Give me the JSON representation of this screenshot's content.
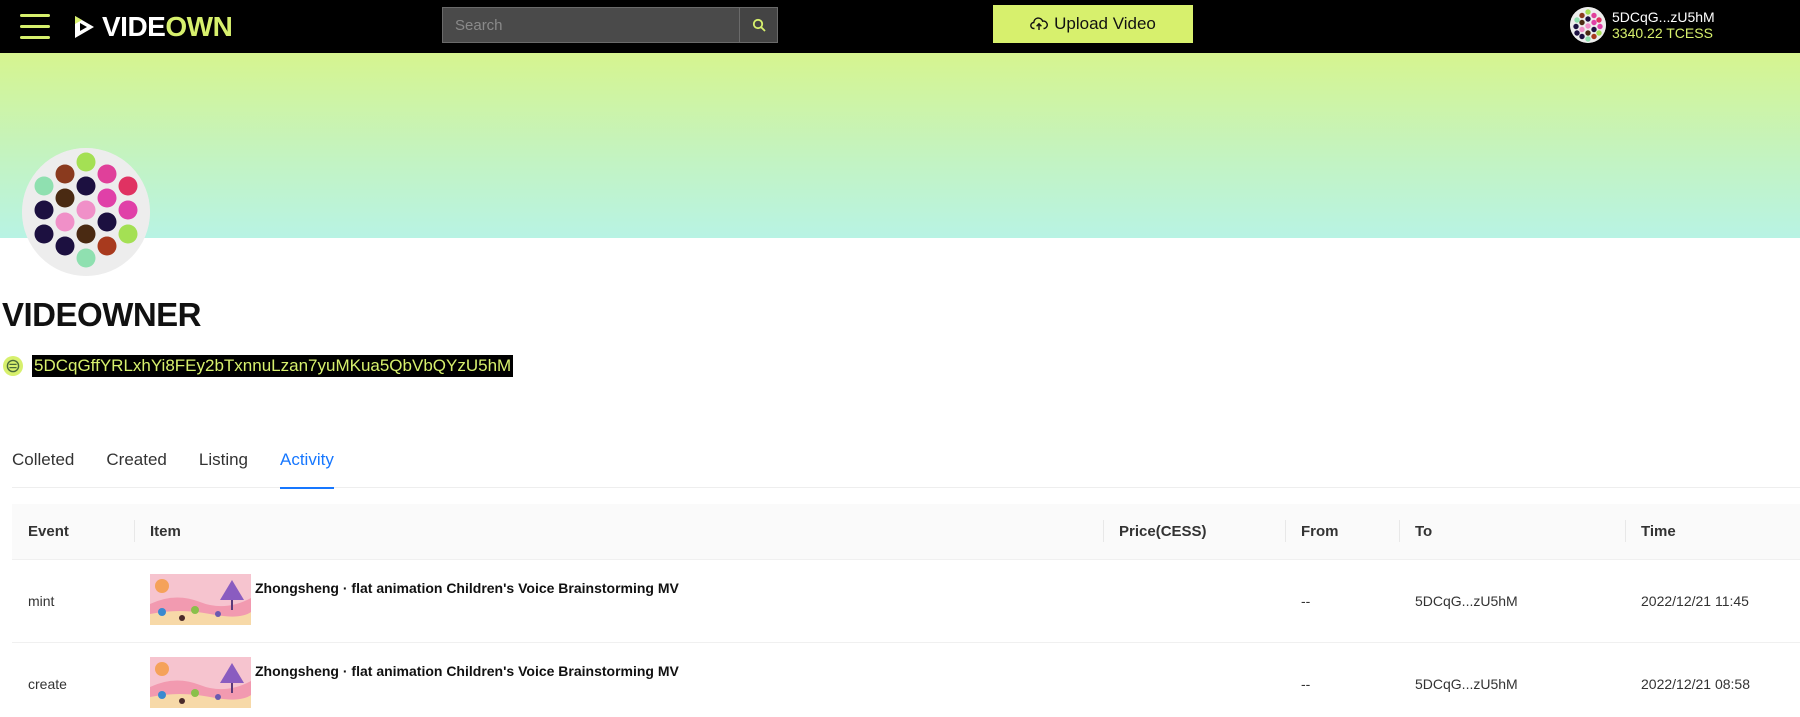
{
  "header": {
    "logo_part1": "VIDE",
    "logo_part2": "OWN",
    "search_placeholder": "Search",
    "upload_label": "Upload Video",
    "account_address": "5DCqG...zU5hM",
    "account_balance": "3340.22 TCESS",
    "accent_color": "#d7f06d"
  },
  "profile": {
    "name": "VIDEOWNER",
    "address": "5DCqGffYRLxhYi8FEy2bTxnnuLzan7yuMKua5QbVbQYzU5hM"
  },
  "tabs": [
    {
      "label": "Colleted",
      "active": false
    },
    {
      "label": "Created",
      "active": false
    },
    {
      "label": "Listing",
      "active": false
    },
    {
      "label": "Activity",
      "active": true
    }
  ],
  "table": {
    "columns": [
      "Event",
      "Item",
      "Price(CESS)",
      "From",
      "To",
      "Time"
    ],
    "rows": [
      {
        "event": "mint",
        "item": "Zhongsheng · flat animation Children's Voice Brainstorming MV",
        "price": "",
        "from": "--",
        "to": "5DCqG...zU5hM",
        "time": "2022/12/21 11:45"
      },
      {
        "event": "create",
        "item": "Zhongsheng · flat animation Children's Voice Brainstorming MV",
        "price": "",
        "from": "--",
        "to": "5DCqG...zU5hM",
        "time": "2022/12/21 08:58"
      }
    ]
  },
  "icons": {
    "menu": "hamburger-icon",
    "logo": "play-logo-icon",
    "search": "search-icon",
    "upload": "cloud-upload-icon",
    "chain": "cess-chain-icon"
  }
}
